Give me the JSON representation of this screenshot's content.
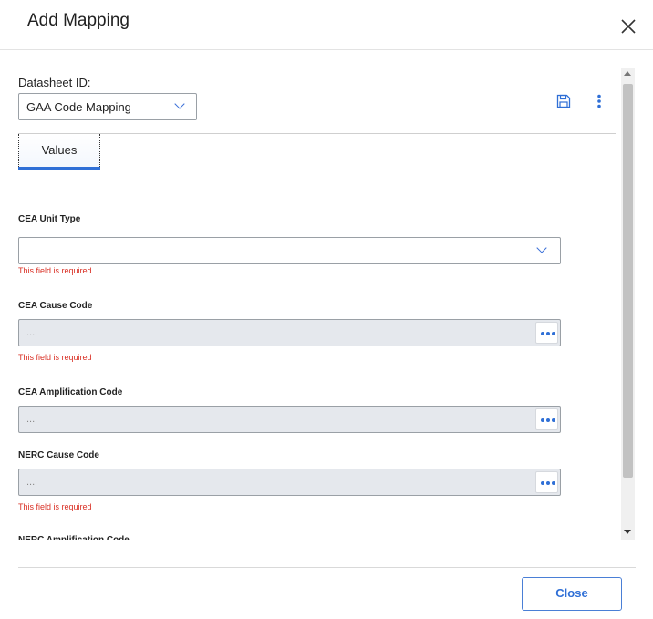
{
  "dialog": {
    "title": "Add Mapping",
    "close_button_label": "Close"
  },
  "datasheet": {
    "label": "Datasheet ID:",
    "selected": "GAA Code Mapping"
  },
  "tabs": [
    {
      "label": "Values",
      "active": true
    }
  ],
  "fields": [
    {
      "label": "CEA Unit Type",
      "type": "dropdown",
      "value": "",
      "error": "This field is required"
    },
    {
      "label": "CEA Cause Code",
      "type": "lookup",
      "placeholder": "...",
      "error": "This field is required"
    },
    {
      "label": "CEA Amplification Code",
      "type": "lookup",
      "placeholder": "...",
      "error": ""
    },
    {
      "label": "NERC Cause Code",
      "type": "lookup",
      "placeholder": "...",
      "error": "This field is required"
    }
  ],
  "partial_field_label": "NERC Amplification Code",
  "colors": {
    "accent": "#2f6fd6",
    "error": "#d93025",
    "disabled_field_bg": "#e5e8ed"
  },
  "icons": [
    "close-icon",
    "chevron-down-icon",
    "save-icon",
    "kebab-menu-icon",
    "ellipsis-icon"
  ]
}
